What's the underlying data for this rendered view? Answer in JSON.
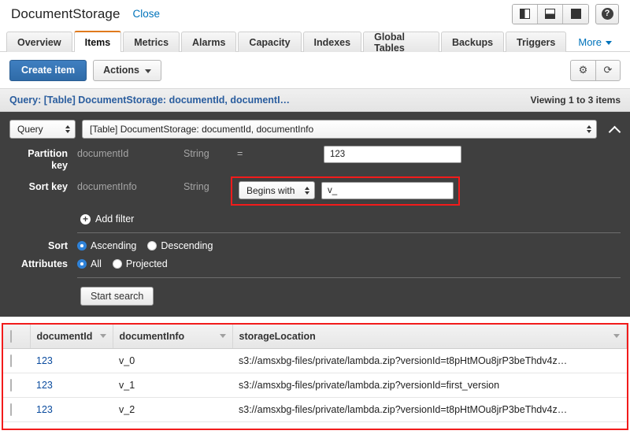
{
  "header": {
    "table_name": "DocumentStorage",
    "close_label": "Close",
    "layout_buttons": [
      {
        "name": "split-vertical-icon",
        "active": true
      },
      {
        "name": "split-horizontal-icon",
        "active": false
      },
      {
        "name": "full-pane-icon",
        "active": false
      }
    ],
    "help_label": "?"
  },
  "tabs": [
    {
      "label": "Overview",
      "active": false
    },
    {
      "label": "Items",
      "active": true
    },
    {
      "label": "Metrics",
      "active": false
    },
    {
      "label": "Alarms",
      "active": false
    },
    {
      "label": "Capacity",
      "active": false
    },
    {
      "label": "Indexes",
      "active": false
    },
    {
      "label": "Global Tables",
      "active": false
    },
    {
      "label": "Backups",
      "active": false
    },
    {
      "label": "Triggers",
      "active": false
    }
  ],
  "more_tab": {
    "label": "More"
  },
  "toolbar": {
    "create_item_label": "Create item",
    "actions_label": "Actions",
    "settings_icon": "⚙",
    "refresh_icon": "⟳"
  },
  "query_bar": {
    "title": "Query: [Table] DocumentStorage: documentId, documentI…",
    "viewing": "Viewing 1 to 3 items"
  },
  "query_panel": {
    "operation": "Query",
    "index": "[Table] DocumentStorage: documentId, documentInfo",
    "partition_key": {
      "label": "Partition key",
      "name": "documentId",
      "type": "String",
      "operator": "=",
      "value": "123"
    },
    "sort_key": {
      "label": "Sort key",
      "name": "documentInfo",
      "type": "String",
      "operator": "Begins with",
      "value": "v_"
    },
    "add_filter_label": "Add filter",
    "sort": {
      "label": "Sort",
      "options": [
        {
          "label": "Ascending",
          "selected": true
        },
        {
          "label": "Descending",
          "selected": false
        }
      ]
    },
    "attributes": {
      "label": "Attributes",
      "options": [
        {
          "label": "All",
          "selected": true
        },
        {
          "label": "Projected",
          "selected": false
        }
      ]
    },
    "start_search_label": "Start search"
  },
  "results": {
    "columns": [
      "documentId",
      "documentInfo",
      "storageLocation"
    ],
    "rows": [
      {
        "documentId": "123",
        "documentInfo": "v_0",
        "storageLocation": "s3://amsxbg-files/private/lambda.zip?versionId=t8pHtMOu8jrP3beThdv4z…"
      },
      {
        "documentId": "123",
        "documentInfo": "v_1",
        "storageLocation": "s3://amsxbg-files/private/lambda.zip?versionId=first_version"
      },
      {
        "documentId": "123",
        "documentInfo": "v_2",
        "storageLocation": "s3://amsxbg-files/private/lambda.zip?versionId=t8pHtMOu8jrP3beThdv4z…"
      }
    ]
  },
  "colors": {
    "accent_blue": "#0073bb",
    "active_tab_orange": "#e07a1d",
    "highlight_red": "#f21b1b",
    "panel_dark": "#3f3f3f",
    "link_blue": "#0a4b9e"
  }
}
